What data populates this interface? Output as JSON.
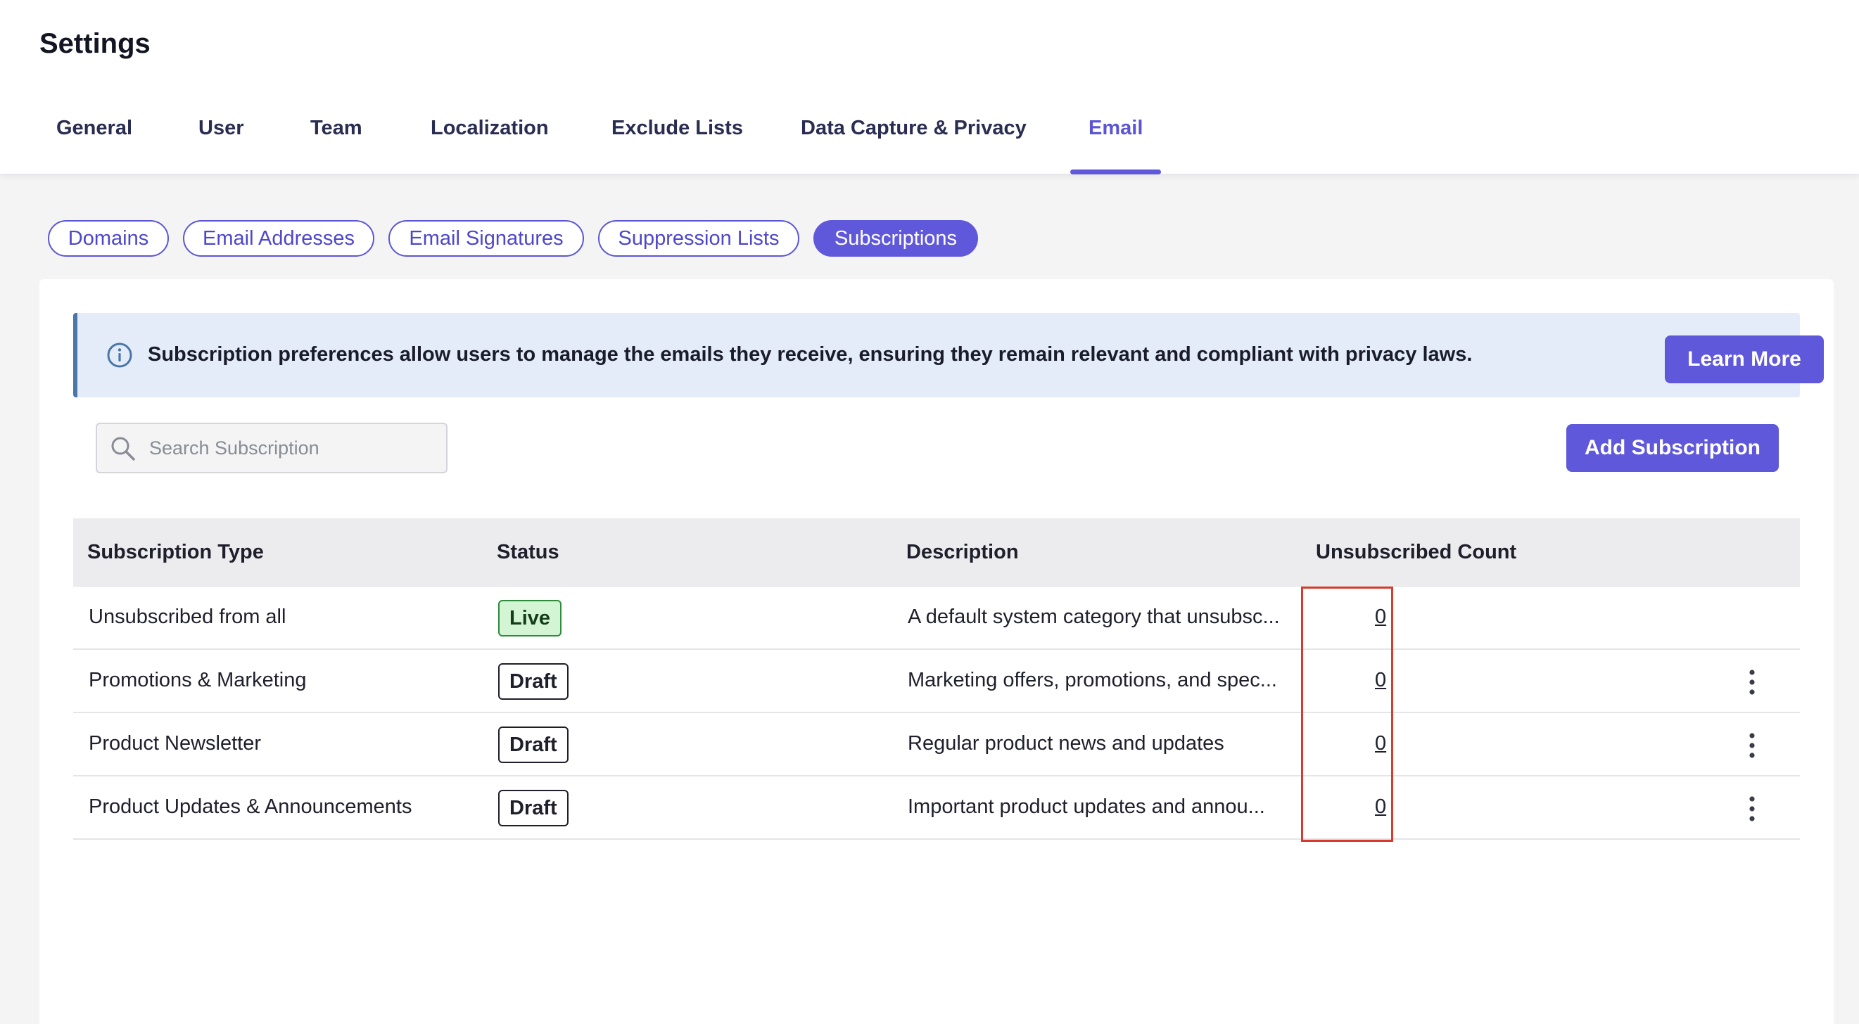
{
  "page_title": "Settings",
  "tabs": [
    {
      "label": "General"
    },
    {
      "label": "User"
    },
    {
      "label": "Team"
    },
    {
      "label": "Localization"
    },
    {
      "label": "Exclude Lists"
    },
    {
      "label": "Data Capture & Privacy"
    },
    {
      "label": "Email",
      "active": true
    }
  ],
  "subtabs": [
    {
      "label": "Domains"
    },
    {
      "label": "Email Addresses"
    },
    {
      "label": "Email Signatures"
    },
    {
      "label": "Suppression Lists"
    },
    {
      "label": "Subscriptions",
      "active": true
    }
  ],
  "banner": {
    "text": "Subscription preferences allow users to manage the emails they receive, ensuring they remain relevant and compliant with privacy laws.",
    "button": "Learn More",
    "icon": "info-icon"
  },
  "search": {
    "placeholder": "Search Subscription",
    "value": ""
  },
  "add_button": "Add Subscription",
  "table": {
    "headers": [
      "Subscription Type",
      "Status",
      "Description",
      "Unsubscribed Count"
    ],
    "rows": [
      {
        "type": "Unsubscribed from all",
        "status": "Live",
        "description": "A default system category that unsubsc...",
        "count": "0",
        "has_menu": false
      },
      {
        "type": "Promotions & Marketing",
        "status": "Draft",
        "description": "Marketing offers, promotions, and spec...",
        "count": "0",
        "has_menu": true
      },
      {
        "type": "Product Newsletter",
        "status": "Draft",
        "description": "Regular product news and updates",
        "count": "0",
        "has_menu": true
      },
      {
        "type": "Product Updates & Announcements",
        "status": "Draft",
        "description": "Important product updates and annou...",
        "count": "0",
        "has_menu": true
      }
    ]
  },
  "colors": {
    "accent": "#6058da",
    "live_badge_bg": "#d4f5d4",
    "banner_bg": "#e3ecf8",
    "highlight": "#d93a2b"
  }
}
